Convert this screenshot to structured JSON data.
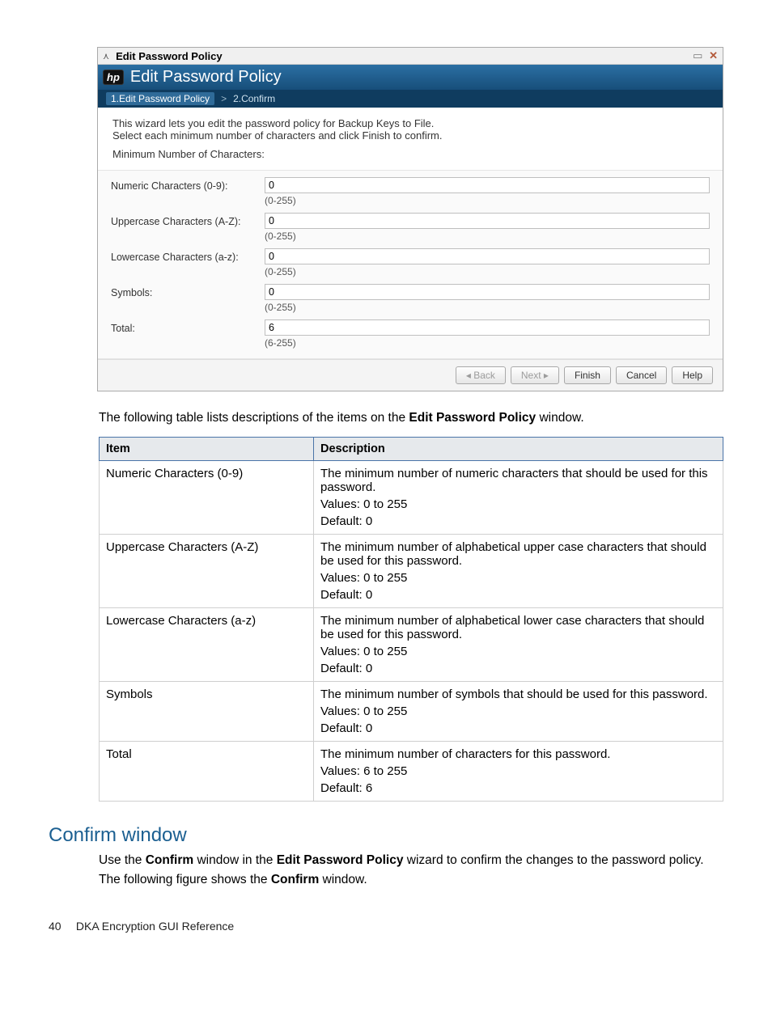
{
  "dialog": {
    "titlebar_title": "Edit Password Policy",
    "header_title": "Edit Password Policy",
    "hp_glyph": "hp",
    "steps": {
      "step1": "1.Edit Password Policy",
      "sep": ">",
      "step2": "2.Confirm"
    },
    "intro_line1": "This wizard lets you edit the password policy for Backup Keys to File.",
    "intro_line2": "Select each minimum number of characters and click Finish to confirm.",
    "section_label": "Minimum Number of Characters:",
    "fields": [
      {
        "label": "Numeric Characters (0-9):",
        "value": "0",
        "hint": "(0-255)"
      },
      {
        "label": "Uppercase Characters (A-Z):",
        "value": "0",
        "hint": "(0-255)"
      },
      {
        "label": "Lowercase Characters (a-z):",
        "value": "0",
        "hint": "(0-255)"
      },
      {
        "label": "Symbols:",
        "value": "0",
        "hint": "(0-255)"
      },
      {
        "label": "Total:",
        "value": "6",
        "hint": "(6-255)"
      }
    ],
    "buttons": {
      "back": "Back",
      "next": "Next",
      "finish": "Finish",
      "cancel": "Cancel",
      "help": "Help"
    }
  },
  "caption": {
    "pre": "The following table lists descriptions of the items on the ",
    "bold": "Edit Password Policy",
    "post": " window."
  },
  "table": {
    "headers": {
      "item": "Item",
      "desc": "Description"
    },
    "rows": [
      {
        "item": "Numeric Characters (0-9)",
        "desc": "The minimum number of numeric characters that should be used for this password.",
        "values": "Values: 0 to 255",
        "default": "Default: 0"
      },
      {
        "item": "Uppercase Characters (A-Z)",
        "desc": "The minimum number of alphabetical upper case characters that should be used for this password.",
        "values": "Values: 0 to 255",
        "default": "Default: 0"
      },
      {
        "item": "Lowercase Characters (a-z)",
        "desc": "The minimum number of alphabetical lower case characters that should be used for this password.",
        "values": "Values: 0 to 255",
        "default": "Default: 0"
      },
      {
        "item": "Symbols",
        "desc": "The minimum number of symbols that should be used for this password.",
        "values": "Values: 0 to 255",
        "default": "Default: 0"
      },
      {
        "item": "Total",
        "desc": "The minimum number of characters for this password.",
        "values": "Values: 6 to 255",
        "default": "Default: 6"
      }
    ]
  },
  "section2": {
    "heading": "Confirm window",
    "p1_pre": "Use the ",
    "p1_b1": "Confirm",
    "p1_mid": " window in the ",
    "p1_b2": "Edit Password Policy",
    "p1_post": " wizard to confirm the changes to the password policy.",
    "p2_pre": "The following figure shows the ",
    "p2_b": "Confirm",
    "p2_post": " window."
  },
  "footer": {
    "pagenum": "40",
    "title": "DKA Encryption GUI Reference"
  }
}
